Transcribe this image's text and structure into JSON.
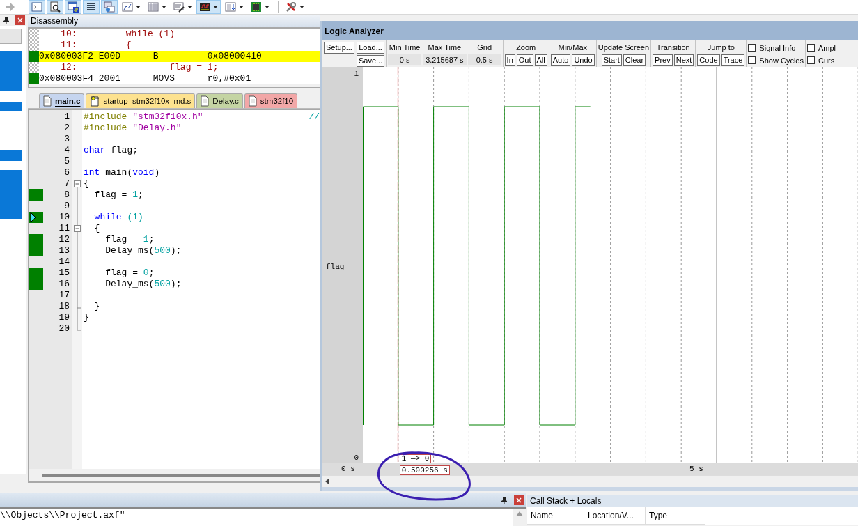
{
  "toolbar": [
    {
      "kind": "step",
      "selected": false,
      "dropdown": false
    },
    {
      "kind": "command",
      "selected": true,
      "dropdown": false
    },
    {
      "kind": "find",
      "selected": true,
      "dropdown": false
    },
    {
      "kind": "symbols",
      "selected": true,
      "dropdown": false
    },
    {
      "kind": "registers",
      "selected": true,
      "dropdown": false
    },
    {
      "kind": "callstack",
      "selected": true,
      "dropdown": false
    },
    {
      "kind": "watch",
      "selected": false,
      "dropdown": true
    },
    {
      "kind": "memory",
      "selected": false,
      "dropdown": true
    },
    {
      "kind": "serial",
      "selected": false,
      "dropdown": true
    },
    {
      "kind": "analysis",
      "selected": true,
      "dropdown": true
    },
    {
      "kind": "trace",
      "selected": false,
      "dropdown": true
    },
    {
      "kind": "system",
      "selected": false,
      "dropdown": true
    },
    {
      "kind": "tools",
      "selected": false,
      "dropdown": true
    }
  ],
  "disassembly": {
    "title": "Disassembly",
    "lines": [
      {
        "kind": "source",
        "executed": false,
        "current": false,
        "number": "10:",
        "code": "while (1)"
      },
      {
        "kind": "source",
        "executed": false,
        "current": false,
        "number": "11:",
        "code": "{"
      },
      {
        "kind": "instruction",
        "executed": true,
        "current": true,
        "address": "0x080003F2",
        "opcode": "E00D",
        "mnemonic": "B",
        "operand": "0x08000410"
      },
      {
        "kind": "source",
        "executed": false,
        "current": false,
        "number": "12:",
        "code": "        flag = 1;"
      },
      {
        "kind": "instruction",
        "executed": true,
        "current": false,
        "address": "0x080003F4",
        "opcode": "2001",
        "mnemonic": "MOVS",
        "operand": "r0,#0x01"
      }
    ]
  },
  "editor": {
    "tabs": [
      {
        "label": "main.c",
        "kind": "file",
        "selected": true,
        "color": "#c6d5ef"
      },
      {
        "label": "startup_stm32f10x_md.s",
        "kind": "startup",
        "selected": false,
        "color": "#fde28f"
      },
      {
        "label": "Delay.c",
        "kind": "file",
        "selected": false,
        "color": "#c4d4a3"
      },
      {
        "label": "stm32f10",
        "kind": "file",
        "selected": false,
        "color": "#f2a7a7"
      }
    ],
    "lines": [
      {
        "number": "1",
        "kind": "plain",
        "executed": false,
        "current": false,
        "tokens": [
          {
            "kind": "directive",
            "text": "#include"
          },
          {
            "kind": "string",
            "text": " \"stm32f10x.h\""
          }
        ],
        "comment": "//"
      },
      {
        "number": "2",
        "kind": "plain",
        "executed": false,
        "current": false,
        "tokens": [
          {
            "kind": "directive",
            "text": "#include"
          },
          {
            "kind": "string",
            "text": " \"Delay.h\""
          }
        ]
      },
      {
        "number": "3",
        "kind": "plain",
        "executed": false,
        "current": false
      },
      {
        "number": "4",
        "kind": "plain",
        "executed": false,
        "current": false,
        "tokens": [
          {
            "kind": "keyword",
            "text": "char"
          },
          {
            "kind": "plain",
            "text": " flag;"
          }
        ]
      },
      {
        "number": "5",
        "kind": "plain",
        "executed": false,
        "current": false
      },
      {
        "number": "6",
        "kind": "plain",
        "executed": false,
        "current": false,
        "tokens": [
          {
            "kind": "keyword",
            "text": "int"
          },
          {
            "kind": "plain",
            "text": " main("
          },
          {
            "kind": "keyword",
            "text": "void"
          },
          {
            "kind": "plain",
            "text": ")"
          }
        ]
      },
      {
        "number": "7",
        "kind": "open",
        "executed": false,
        "current": false,
        "tokens": [
          {
            "kind": "plain",
            "text": "{"
          }
        ]
      },
      {
        "number": "8",
        "kind": "inside",
        "executed": true,
        "current": false,
        "tokens": [
          {
            "kind": "plain",
            "text": "  flag = "
          },
          {
            "kind": "number",
            "text": "1"
          },
          {
            "kind": "plain",
            "text": ";"
          }
        ]
      },
      {
        "number": "9",
        "kind": "inside",
        "executed": false,
        "current": false
      },
      {
        "number": "10",
        "kind": "inside",
        "executed": true,
        "current": true,
        "tokens": [
          {
            "kind": "keyword",
            "text": "  while"
          },
          {
            "kind": "number",
            "text": " (1)"
          }
        ]
      },
      {
        "number": "11",
        "kind": "open",
        "executed": false,
        "current": false,
        "tokens": [
          {
            "kind": "plain",
            "text": "  {"
          }
        ]
      },
      {
        "number": "12",
        "kind": "inside",
        "executed": true,
        "current": false,
        "tokens": [
          {
            "kind": "plain",
            "text": "    flag = "
          },
          {
            "kind": "number",
            "text": "1"
          },
          {
            "kind": "plain",
            "text": ";"
          }
        ]
      },
      {
        "number": "13",
        "kind": "inside",
        "executed": true,
        "current": false,
        "tokens": [
          {
            "kind": "plain",
            "text": "    Delay_ms("
          },
          {
            "kind": "number",
            "text": "500"
          },
          {
            "kind": "plain",
            "text": ");"
          }
        ]
      },
      {
        "number": "14",
        "kind": "inside",
        "executed": false,
        "current": false
      },
      {
        "number": "15",
        "kind": "inside",
        "executed": true,
        "current": false,
        "tokens": [
          {
            "kind": "plain",
            "text": "    flag = "
          },
          {
            "kind": "number",
            "text": "0"
          },
          {
            "kind": "plain",
            "text": ";"
          }
        ]
      },
      {
        "number": "16",
        "kind": "inside",
        "executed": true,
        "current": false,
        "tokens": [
          {
            "kind": "plain",
            "text": "    Delay_ms("
          },
          {
            "kind": "number",
            "text": "500"
          },
          {
            "kind": "plain",
            "text": ");"
          }
        ]
      },
      {
        "number": "17",
        "kind": "inside",
        "executed": false,
        "current": false
      },
      {
        "number": "18",
        "kind": "close",
        "executed": false,
        "current": false,
        "tokens": [
          {
            "kind": "plain",
            "text": "  }"
          }
        ]
      },
      {
        "number": "19",
        "kind": "inside",
        "executed": false,
        "current": false,
        "tokens": [
          {
            "kind": "plain",
            "text": "}"
          }
        ]
      },
      {
        "number": "20",
        "kind": "last",
        "executed": false,
        "current": false
      }
    ]
  },
  "logic_analyzer": {
    "title": "Logic Analyzer",
    "sections": [
      {
        "kind": "file",
        "buttons": [
          "Setup...",
          "Load...",
          "Save..."
        ]
      },
      {
        "kind": "readouts",
        "items": [
          {
            "label": "Min Time",
            "value": "0 s"
          },
          {
            "label": "Max Time",
            "value": "3.215687 s"
          },
          {
            "label": "Grid",
            "value": "0.5 s"
          }
        ]
      },
      {
        "kind": "buttons",
        "label": "Zoom",
        "buttons": [
          "In",
          "Out",
          "All"
        ]
      },
      {
        "kind": "buttons",
        "label": "Min/Max",
        "buttons": [
          "Auto",
          "Undo"
        ]
      },
      {
        "kind": "buttons",
        "label": "Update Screen",
        "buttons": [
          "Start",
          "Clear"
        ]
      },
      {
        "kind": "buttons",
        "label": "Transition",
        "buttons": [
          "Prev",
          "Next"
        ]
      },
      {
        "kind": "buttons",
        "label": "Jump to",
        "buttons": [
          "Code",
          "Trace"
        ]
      },
      {
        "kind": "options",
        "items": [
          {
            "label": "Signal Info",
            "checked": false
          },
          {
            "label": "Show Cycles",
            "checked": false
          }
        ]
      },
      {
        "kind": "options",
        "items": [
          {
            "label": "Ampl",
            "checked": false
          },
          {
            "label": "Curs",
            "checked": false
          }
        ]
      }
    ],
    "signal": {
      "name": "flag",
      "high": "1",
      "low": "0"
    },
    "time_labels": [
      "0 s",
      "5 s"
    ],
    "cursor": {
      "transition": "1 —> 0",
      "time": "0.500256 s"
    }
  },
  "output": {
    "text": "\\\\Objects\\\\Project.axf\""
  },
  "call_stack": {
    "title": "Call Stack + Locals",
    "columns": [
      "Name",
      "Location/V...",
      "Type"
    ]
  }
}
